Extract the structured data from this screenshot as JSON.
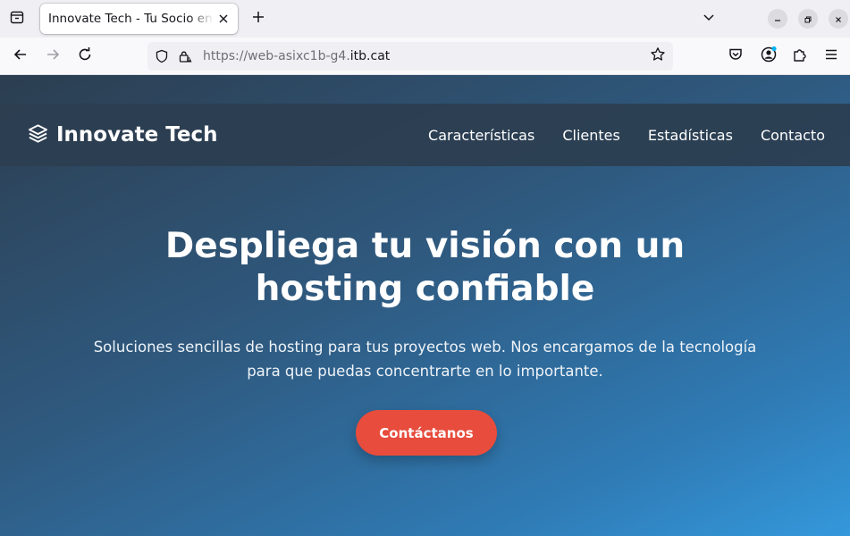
{
  "browser": {
    "tab_title": "Innovate Tech - Tu Socio en Hosting",
    "url_prefix": "https://web-asixc1b-g4.",
    "url_host": "itb.cat"
  },
  "site": {
    "logo_text": "Innovate Tech",
    "nav": [
      "Características",
      "Clientes",
      "Estadísticas",
      "Contacto"
    ]
  },
  "hero": {
    "title": "Despliega tu visión con un hosting confiable",
    "subtitle": "Soluciones sencillas de hosting para tus proyectos web. Nos encargamos de la tecnología para que puedas concentrarte en lo importante.",
    "cta_label": "Contáctanos"
  },
  "colors": {
    "header_bg": "#2c3e50",
    "gradient_start": "#2c3e50",
    "gradient_end": "#3498db",
    "cta": "#e74c3c"
  },
  "icons": [
    "tab-list-icon",
    "close-icon",
    "plus-icon",
    "chevron-down-icon",
    "minimize-icon",
    "restore-icon",
    "window-close-icon",
    "back-arrow-icon",
    "forward-arrow-icon",
    "reload-icon",
    "shield-icon",
    "lock-warning-icon",
    "star-icon",
    "pocket-icon",
    "account-icon",
    "extensions-icon",
    "menu-icon",
    "layers-icon"
  ]
}
